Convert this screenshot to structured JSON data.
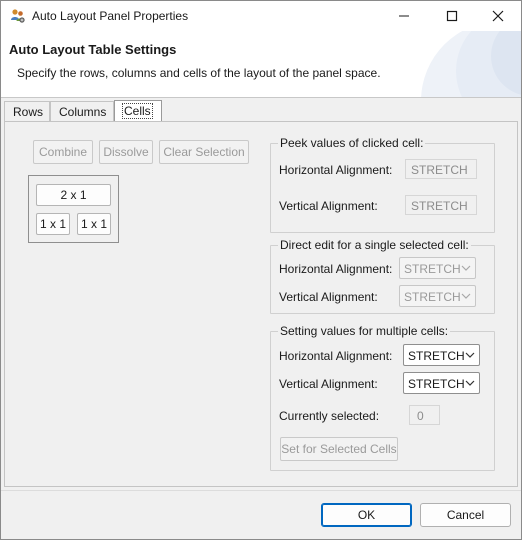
{
  "window": {
    "title": "Auto Layout Panel Properties",
    "icons": {
      "app": "people-gear-icon",
      "minimize": "minimize-icon",
      "maximize": "maximize-icon",
      "close": "close-icon"
    }
  },
  "banner": {
    "title": "Auto Layout Table Settings",
    "description": "Specify the rows, columns and cells of the layout of the panel space."
  },
  "tabs": [
    {
      "label": "Rows"
    },
    {
      "label": "Columns"
    },
    {
      "label": "Cells",
      "active": true
    }
  ],
  "cells_tab": {
    "toolbar": {
      "combine": "Combine",
      "dissolve": "Dissolve",
      "clear_selection": "Clear Selection"
    },
    "cell_grid": {
      "top": "2 x 1",
      "bottom_left": "1 x 1",
      "bottom_right": "1 x 1"
    },
    "peek_group": {
      "title": "Peek values of clicked cell:",
      "h_label": "Horizontal Alignment:",
      "h_value": "STRETCH",
      "v_label": "Vertical Alignment:",
      "v_value": "STRETCH"
    },
    "direct_group": {
      "title": "Direct edit for a single selected cell:",
      "h_label": "Horizontal Alignment:",
      "h_value": "STRETCH",
      "v_label": "Vertical Alignment:",
      "v_value": "STRETCH"
    },
    "multi_group": {
      "title": "Setting values for multiple cells:",
      "h_label": "Horizontal Alignment:",
      "h_value": "STRETCH",
      "v_label": "Vertical Alignment:",
      "v_value": "STRETCH",
      "selected_label": "Currently selected:",
      "selected_value": "0",
      "set_button": "Set for Selected Cells"
    }
  },
  "footer": {
    "ok": "OK",
    "cancel": "Cancel"
  },
  "colors": {
    "accent": "#0067c0",
    "window_bg": "#f0f0f0",
    "banner_bg": "#ffffff"
  }
}
